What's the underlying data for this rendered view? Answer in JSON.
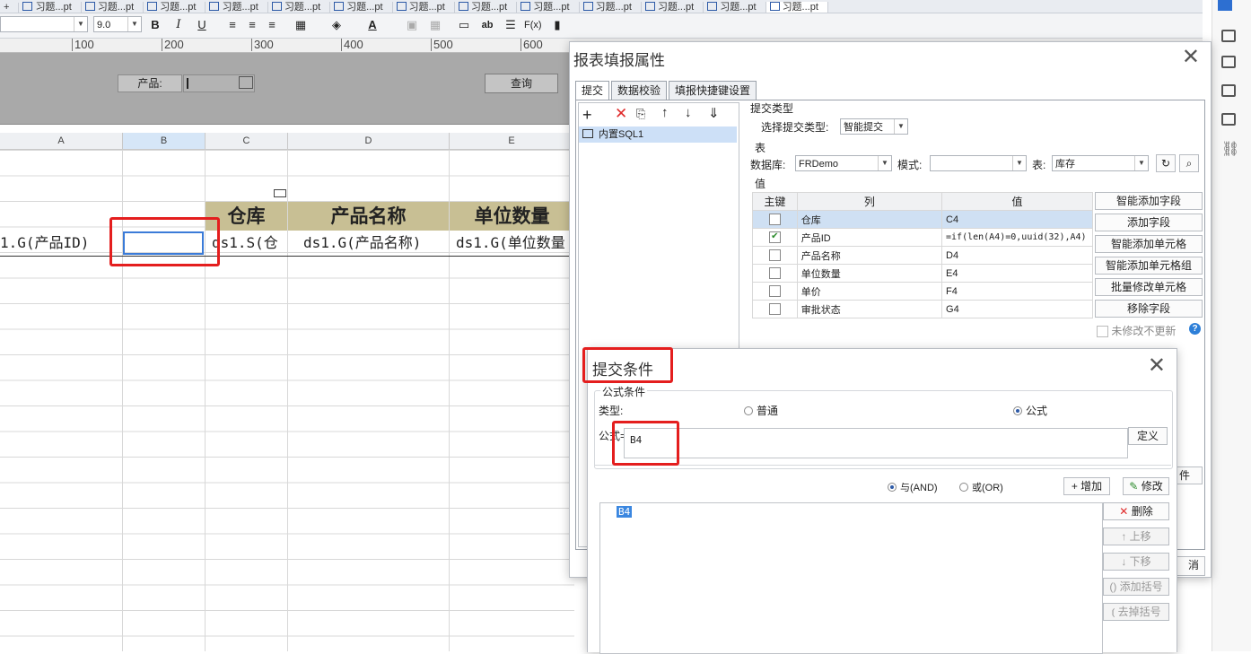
{
  "tabs": [
    "+",
    "习题...pt",
    "习题...pt",
    "习题...pt",
    "习题...pt",
    "习题...pt",
    "习题...pt",
    "习题...pt",
    "习题...pt",
    "习题...pt",
    "习题...pt",
    "习题...pt",
    "习题...pt",
    "习题...pt"
  ],
  "toolbar": {
    "font_size": "9.0",
    "bold": "B",
    "italic": "I",
    "underline": "U",
    "text_tool": "ab",
    "fx": "F(x)"
  },
  "ruler": [
    "100",
    "200",
    "300",
    "400",
    "500",
    "600"
  ],
  "param": {
    "product_label": "产品:",
    "query_button": "查询"
  },
  "sheet": {
    "columns": [
      "A",
      "B",
      "C",
      "D",
      "E"
    ],
    "headers": [
      "仓库",
      "产品名称",
      "单位数量"
    ],
    "row4": {
      "a4": "1.G(产品ID)",
      "c4": "ds1.S(仓",
      "d4": "ds1.G(产品名称)",
      "e4": "ds1.G(单位数量"
    }
  },
  "report_dialog": {
    "title": "报表填报属性",
    "tabs": [
      "提交",
      "数据校验",
      "填报快捷键设置"
    ],
    "tree_item": "内置SQL1",
    "submit_type_section": "提交类型",
    "submit_type_label": "选择提交类型:",
    "submit_type_value": "智能提交",
    "table_section": "表",
    "db_label": "数据库:",
    "db_value": "FRDemo",
    "mode_label": "模式:",
    "table_label": "表:",
    "table_value": "库存",
    "value_section": "值",
    "col_headers": [
      "主键",
      "列",
      "值"
    ],
    "rows": [
      {
        "key": false,
        "column": "仓库",
        "value": "C4"
      },
      {
        "key": true,
        "column": "产品ID",
        "value": "=if(len(A4)=0,uuid(32),A4)"
      },
      {
        "key": false,
        "column": "产品名称",
        "value": "D4"
      },
      {
        "key": false,
        "column": "单位数量",
        "value": "E4"
      },
      {
        "key": false,
        "column": "单价",
        "value": "F4"
      },
      {
        "key": false,
        "column": "审批状态",
        "value": "G4"
      }
    ],
    "side_buttons": [
      "智能添加字段",
      "添加字段",
      "智能添加单元格",
      "智能添加单元格组",
      "批量修改单元格",
      "移除字段"
    ],
    "unmodified_label": "未修改不更新",
    "help": "?",
    "cancel_partial": "消",
    "partial_right": "件"
  },
  "condition_dialog": {
    "title": "提交条件",
    "section": "公式条件",
    "type_label": "类型:",
    "radio_normal": "普通",
    "radio_formula": "公式",
    "formula_label": "公式=",
    "formula_value": "B4",
    "define_button": "定义",
    "and_label": "与(AND)",
    "or_label": "或(OR)",
    "add_button": "增加",
    "modify_button": "修改",
    "list_item": "B4",
    "buttons": [
      "删除",
      "上移",
      "下移",
      "添加括号",
      "去掉括号"
    ]
  }
}
